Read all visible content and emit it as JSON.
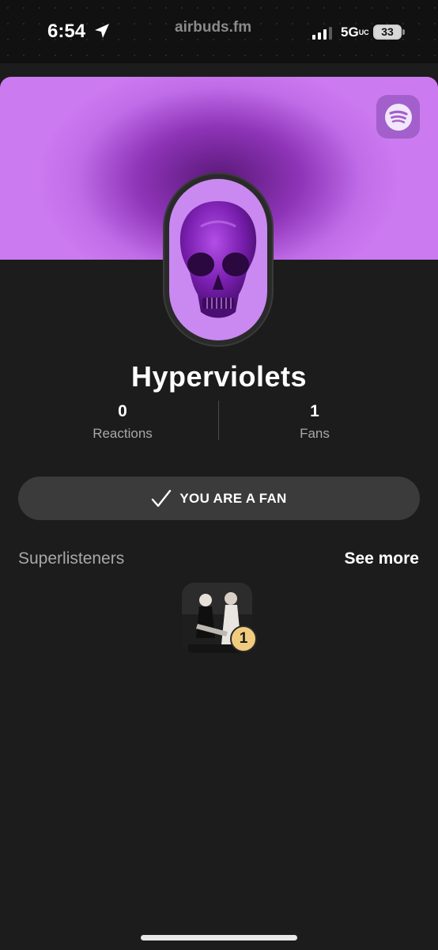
{
  "status_bar": {
    "time": "6:54",
    "site": "airbuds.fm",
    "network": "5G",
    "network_suffix": "UC",
    "battery": "33",
    "icons": [
      "location-arrow-icon",
      "signal-bars-icon",
      "battery-icon"
    ]
  },
  "artist": {
    "name": "Hyperviolets",
    "accent_color": "#c06ce8",
    "streaming_icon": "spotify-icon"
  },
  "stats": [
    {
      "value": "0",
      "label": "Reactions"
    },
    {
      "value": "1",
      "label": "Fans"
    }
  ],
  "fan_button": {
    "label": "YOU ARE A FAN",
    "icon": "checkmark-icon"
  },
  "superlisteners": {
    "title": "Superlisteners",
    "see_more": "See more",
    "items": [
      {
        "rank": "1"
      }
    ],
    "badge_color": "#f1cc7e"
  }
}
